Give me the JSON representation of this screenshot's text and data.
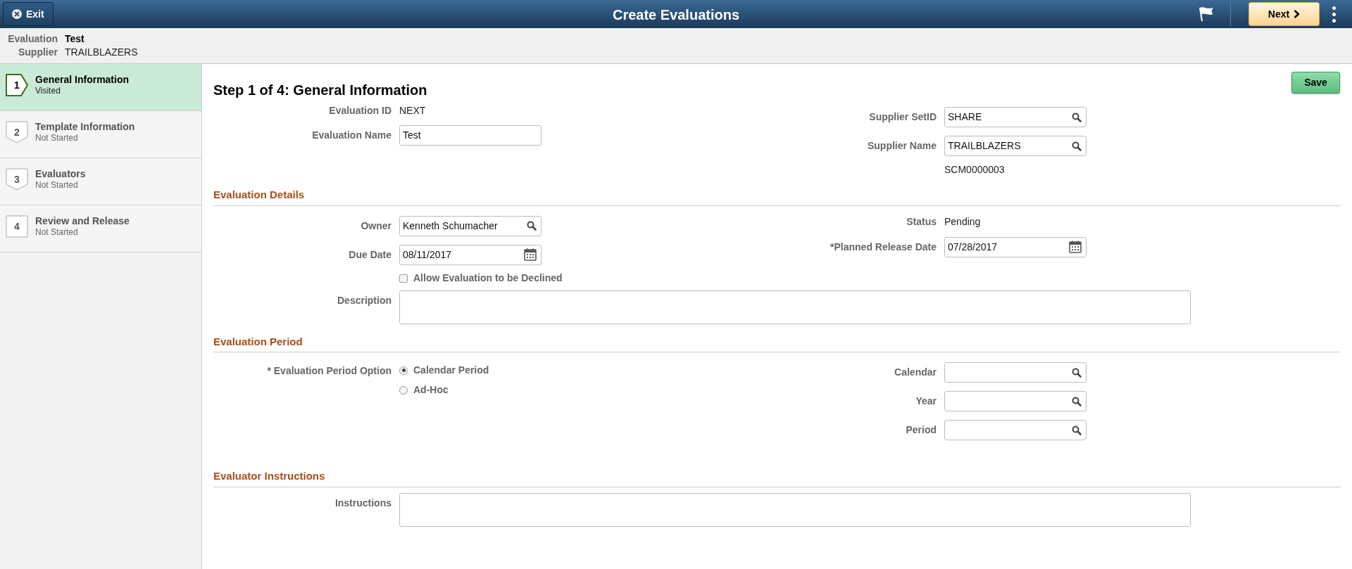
{
  "header": {
    "exit": "Exit",
    "title": "Create Evaluations",
    "next": "Next"
  },
  "context": [
    {
      "label": "Evaluation",
      "value": "Test",
      "bold": true
    },
    {
      "label": "Supplier",
      "value": "TRAILBLAZERS",
      "bold": false
    }
  ],
  "steps": [
    {
      "number": "1",
      "title": "General Information",
      "status": "Visited",
      "selected": true
    },
    {
      "number": "2",
      "title": "Template Information",
      "status": "Not Started",
      "selected": false
    },
    {
      "number": "3",
      "title": "Evaluators",
      "status": "Not Started",
      "selected": false
    },
    {
      "number": "4",
      "title": "Review and Release",
      "status": "Not Started",
      "selected": false
    }
  ],
  "page_title": "Step 1 of 4: General Information",
  "save": "Save",
  "sections": [
    {
      "left": [
        {
          "kind": "display",
          "label": "Evaluation ID",
          "value": "NEXT"
        },
        {
          "kind": "input",
          "label": "Evaluation Name",
          "value": "Test"
        }
      ],
      "right": [
        {
          "kind": "lookup",
          "label": "Supplier SetID",
          "value": "SHARE"
        },
        {
          "kind": "lookup",
          "label": "Supplier Name",
          "value": "TRAILBLAZERS"
        },
        {
          "kind": "note",
          "value": "SCM0000003"
        }
      ]
    },
    {
      "heading": "Evaluation Details",
      "left": [
        {
          "kind": "lookup",
          "label": "Owner",
          "value": "Kenneth Schumacher"
        },
        {
          "kind": "date",
          "label": "Due Date",
          "value": "08/11/2017"
        },
        {
          "kind": "checkbox",
          "label": "Allow Evaluation to be Declined",
          "checked": false
        }
      ],
      "right": [
        {
          "kind": "display",
          "label": "Status",
          "value": "Pending"
        },
        {
          "kind": "date",
          "label": "*Planned Release Date",
          "value": "07/28/2017"
        }
      ],
      "full": [
        {
          "kind": "textarea",
          "label": "Description"
        }
      ]
    },
    {
      "heading": "Evaluation Period",
      "left": [
        {
          "kind": "radio",
          "label": "* Evaluation Period Option",
          "options": [
            {
              "label": "Calendar Period",
              "selected": true
            },
            {
              "label": "Ad-Hoc",
              "selected": false
            }
          ]
        }
      ],
      "right": [
        {
          "kind": "lookup",
          "label": "Calendar"
        },
        {
          "kind": "lookup",
          "label": "Year"
        },
        {
          "kind": "lookup",
          "label": "Period"
        }
      ]
    },
    {
      "heading": "Evaluator Instructions",
      "full": [
        {
          "kind": "textarea",
          "label": "Instructions"
        }
      ]
    }
  ]
}
